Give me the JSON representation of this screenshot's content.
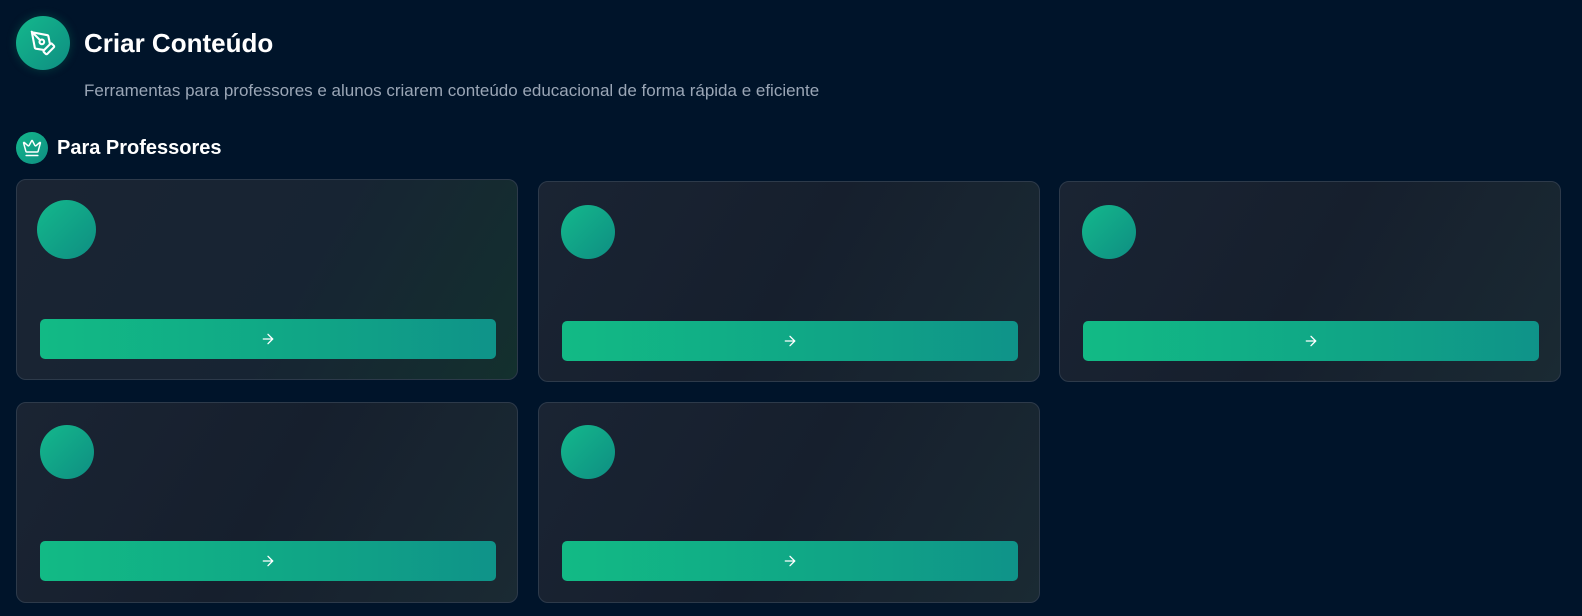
{
  "header": {
    "title": "Criar Conteúdo",
    "subtitle": "Ferramentas para professores e alunos criarem conteúdo educacional de forma rápida e eficiente",
    "icon": "pen-tool-icon"
  },
  "section": {
    "title": "Para Professores",
    "icon": "crown-icon"
  },
  "cards": [
    {
      "icon": "tool-icon",
      "button_icon": "arrow-right-icon"
    },
    {
      "icon": "tool-icon",
      "button_icon": "arrow-right-icon"
    },
    {
      "icon": "tool-icon",
      "button_icon": "arrow-right-icon"
    },
    {
      "icon": "tool-icon",
      "button_icon": "arrow-right-icon"
    },
    {
      "icon": "tool-icon",
      "button_icon": "arrow-right-icon"
    }
  ],
  "colors": {
    "background": "#00142a",
    "accent_start": "#14b88c",
    "accent_end": "#0e8e82",
    "card_border": "#2d3a4a",
    "subtitle_text": "#9aa6b6"
  }
}
